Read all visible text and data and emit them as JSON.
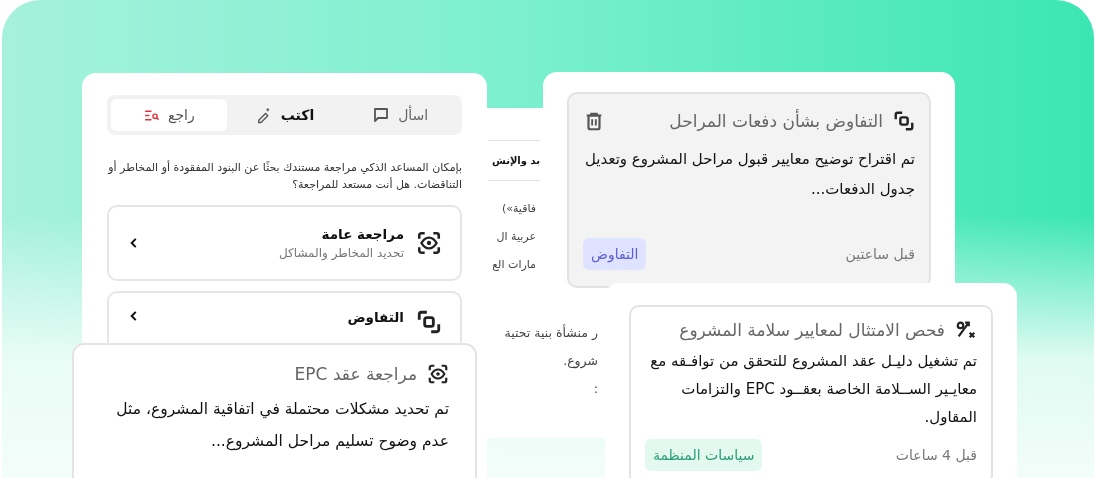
{
  "assistant_panel": {
    "tabs": [
      {
        "label": "اسأل",
        "selected": false,
        "emphasized": false
      },
      {
        "label": "اكتب",
        "selected": false,
        "emphasized": true
      },
      {
        "label": "راجع",
        "selected": true,
        "emphasized": false
      }
    ],
    "intro": "بإمكان المساعد الذكي مراجعة مستندك بحثًا عن البنود المفقودة أو المخاطر أو التناقضات. هل أنت مستعد للمراجعة؟",
    "options": [
      {
        "title": "مراجعة عامة",
        "subtitle": "تحديد المخاطر والمشاكل"
      },
      {
        "title": "التفاوض"
      }
    ]
  },
  "document": {
    "heading": "بد والإنش",
    "upper_lines": [
      "فاقية»)",
      "عربية ال",
      "مارات الع"
    ],
    "lower_lines": [
      "ر منشأة بنية تحتية",
      "شروع.",
      ":"
    ]
  },
  "cards": [
    {
      "title": "التفاوض بشأن دفعات المراحل",
      "text": "تم اقتراح توضيح معايير قبول مراحل المشروع وتعديل جدول الدفعات...",
      "time": "قبل ساعتين",
      "tag": {
        "label": "التفاوض",
        "color": "#e0e3ff"
      },
      "deletable": true
    },
    {
      "title": "فحص الامتثال لمعايير سلامة المشروع",
      "text": "تم تشغيل دليـل عقد المشروع للتحقق من توافـقه مع معايـير الســلامة الخاصة بعقــود EPC والتزامات المقاول.",
      "time": "قبل 4 ساعات",
      "tag": {
        "label": "سياسات المنظمة",
        "color": "#e3f8ef"
      }
    },
    {
      "title": "مراجعة عقد EPC",
      "text": "تم تحديد مشكلات محتملة في اتفاقية المشروع، مثل عدم وضوح تسليم مراحل المشروع..."
    }
  ]
}
